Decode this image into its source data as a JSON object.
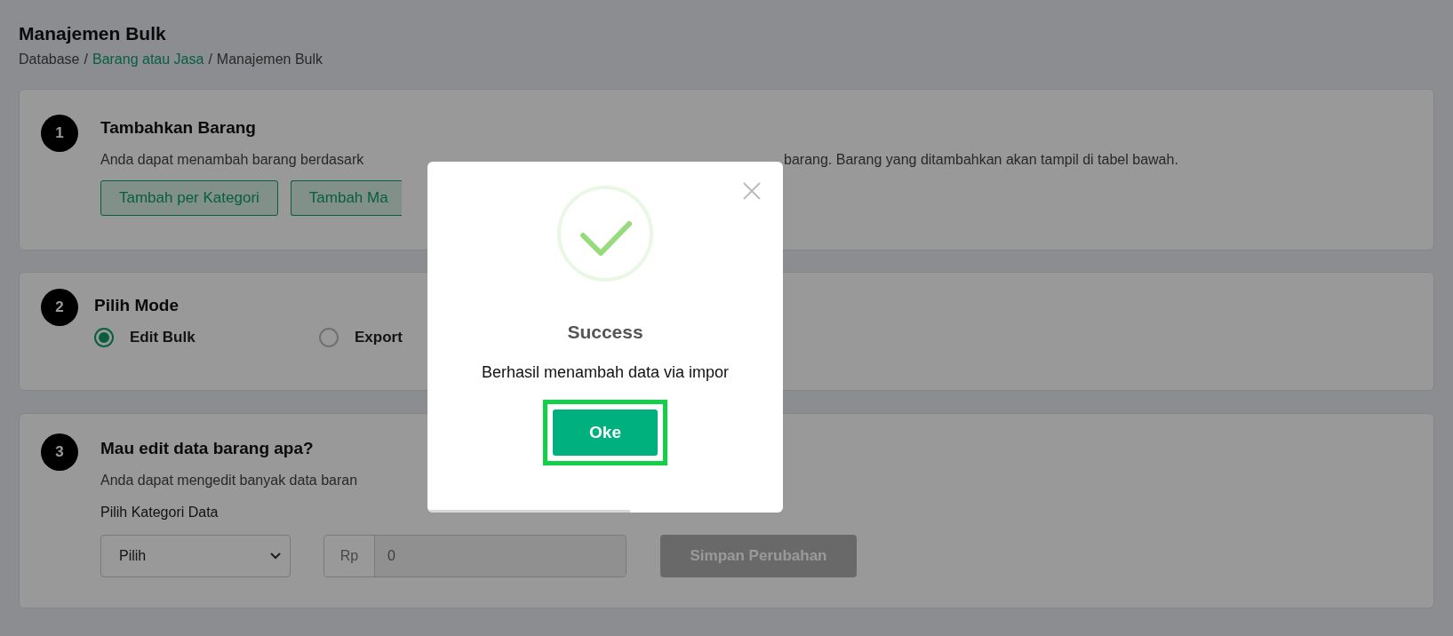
{
  "page": {
    "title": "Manajemen Bulk"
  },
  "breadcrumb_separator": "/",
  "breadcrumb": [
    {
      "label": "Database",
      "link": false
    },
    {
      "label": "Barang atau Jasa",
      "link": true
    },
    {
      "label": "Manajemen Bulk",
      "link": false
    }
  ],
  "steps": [
    {
      "number": "1",
      "title": "Tambahkan Barang",
      "description_left": "Anda dapat menambah barang berdasark",
      "description_right": "barang. Barang yang ditambahkan akan tampil di tabel bawah.",
      "buttons": [
        "Tambah per Kategori",
        "Tambah Ma"
      ]
    },
    {
      "number": "2",
      "title": "Pilih Mode",
      "options": [
        {
          "label": "Edit Bulk",
          "selected": true
        },
        {
          "label": "Export",
          "selected": false
        }
      ]
    },
    {
      "number": "3",
      "title": "Mau edit data barang apa?",
      "description_left": "Anda dapat mengedit banyak data baran",
      "field_label": "Pilih Kategori Data",
      "select": {
        "value": "Pilih"
      },
      "price": {
        "prefix": "Rp",
        "placeholder": "0"
      },
      "save_button": {
        "label": "Simpan Perubahan",
        "disabled": true
      }
    }
  ],
  "dialog": {
    "title": "Success",
    "message": "Berhasil menambah data via impor",
    "button": {
      "label": "Oke",
      "highlighted": true
    },
    "timer": {
      "level": 0.57
    }
  }
}
